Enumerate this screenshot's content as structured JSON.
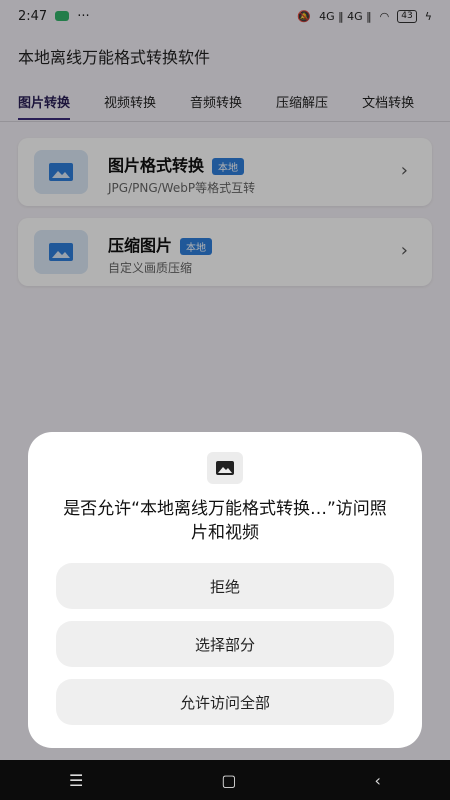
{
  "status": {
    "time": "2:47",
    "dots": "···",
    "signal_text": "4G ‖ 4G ‖",
    "battery": "43"
  },
  "app": {
    "title": "本地离线万能格式转换软件"
  },
  "tabs": [
    {
      "label": "图片转换"
    },
    {
      "label": "视频转换"
    },
    {
      "label": "音频转换"
    },
    {
      "label": "压缩解压"
    },
    {
      "label": "文档转换"
    }
  ],
  "cards": [
    {
      "title": "图片格式转换",
      "badge": "本地",
      "desc": "JPG/PNG/WebP等格式互转"
    },
    {
      "title": "压缩图片",
      "badge": "本地",
      "desc": "自定义画质压缩"
    }
  ],
  "dialog": {
    "message": "是否允许“本地离线万能格式转换…”访问照片和视频",
    "buttons": [
      {
        "label": "拒绝"
      },
      {
        "label": "选择部分"
      },
      {
        "label": "允许访问全部"
      }
    ]
  },
  "nav": {
    "menu": "☰",
    "home": "▢",
    "back": "‹"
  },
  "colors": {
    "accent": "#3b2b7a",
    "badge": "#2f7fdc"
  },
  "icons": {
    "card_icon": "image-icon",
    "dialog_icon": "photo-icon"
  }
}
